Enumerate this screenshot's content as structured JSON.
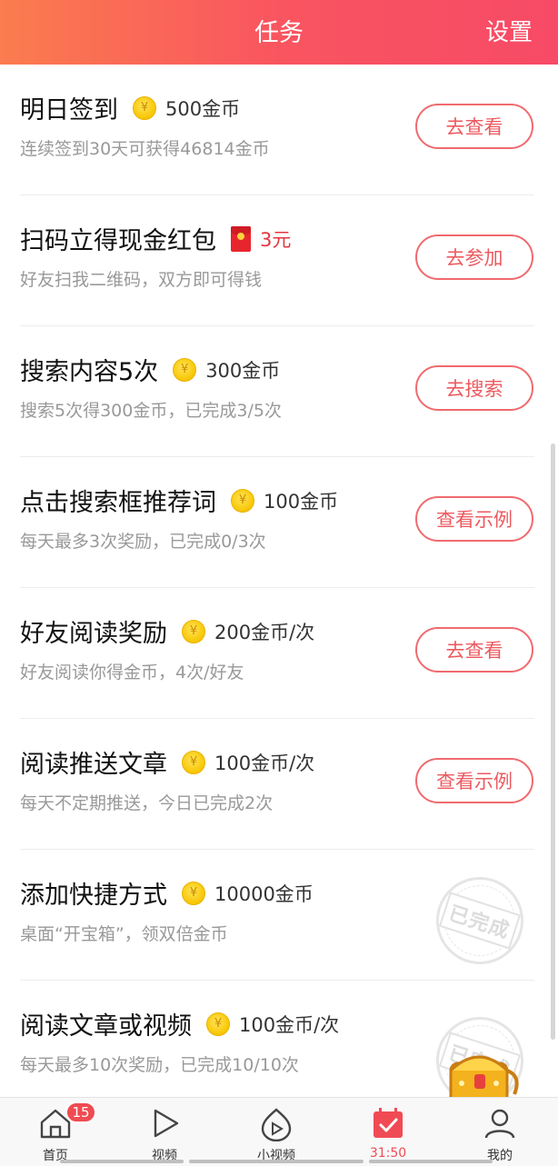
{
  "header": {
    "title": "任务",
    "settings_label": "设置"
  },
  "tasks": [
    {
      "title": "明日签到",
      "reward_icon": "coin-icon",
      "reward": "500金币",
      "desc": "连续签到30天可获得46814金币",
      "action": "去查看",
      "status": "button"
    },
    {
      "title": "扫码立得现金红包",
      "reward_icon": "red-envelope-icon",
      "reward": "3元",
      "desc": "好友扫我二维码，双方即可得钱",
      "action": "去参加",
      "status": "button"
    },
    {
      "title": "搜索内容5次",
      "reward_icon": "coin-icon",
      "reward": "300金币",
      "desc": "搜索5次得300金币，已完成3/5次",
      "action": "去搜索",
      "status": "button"
    },
    {
      "title": "点击搜索框推荐词",
      "reward_icon": "coin-icon",
      "reward": "100金币",
      "desc": "每天最多3次奖励，已完成0/3次",
      "action": "查看示例",
      "status": "button"
    },
    {
      "title": "好友阅读奖励",
      "reward_icon": "coin-icon",
      "reward": "200金币/次",
      "desc": "好友阅读你得金币，4次/好友",
      "action": "去查看",
      "status": "button"
    },
    {
      "title": "阅读推送文章",
      "reward_icon": "coin-icon",
      "reward": "100金币/次",
      "desc": "每天不定期推送，今日已完成2次",
      "action": "查看示例",
      "status": "button"
    },
    {
      "title": "添加快捷方式",
      "reward_icon": "coin-icon",
      "reward": "10000金币",
      "desc": "桌面“开宝箱”，领双倍金币",
      "action": "已完成",
      "status": "done"
    },
    {
      "title": "阅读文章或视频",
      "reward_icon": "coin-icon",
      "reward": "100金币/次",
      "desc": "每天最多10次奖励，已完成10/10次",
      "action": "已完成",
      "status": "done"
    }
  ],
  "coin_symbol": "¥",
  "tabbar": [
    {
      "label": "首页",
      "icon": "home-icon",
      "badge": "15"
    },
    {
      "label": "视频",
      "icon": "play-icon"
    },
    {
      "label": "小视频",
      "icon": "small-video-icon"
    },
    {
      "label": "31:50",
      "icon": "calendar-check-icon",
      "active": true
    },
    {
      "label": "我的",
      "icon": "user-icon"
    }
  ],
  "colors": {
    "accent": "#f04b55",
    "header_start": "#fb7c4e",
    "header_end": "#f74a66",
    "coin": "#f8c500"
  }
}
